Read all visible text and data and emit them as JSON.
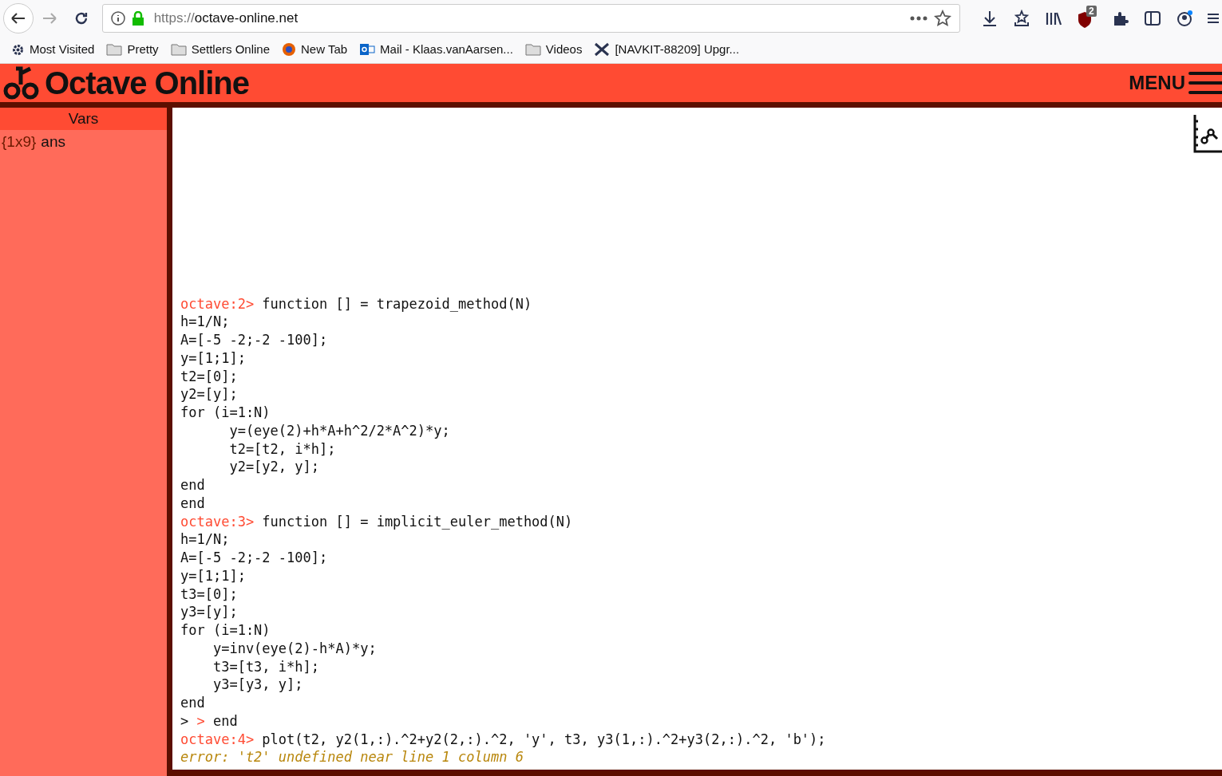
{
  "browser": {
    "url_scheme": "https://",
    "url_host": "octave-online.net",
    "extension_badge": "2"
  },
  "bookmarks": [
    {
      "kind": "gear",
      "label": "Most Visited"
    },
    {
      "kind": "folder",
      "label": "Pretty"
    },
    {
      "kind": "folder",
      "label": "Settlers Online"
    },
    {
      "kind": "globe",
      "label": "New Tab"
    },
    {
      "kind": "mail",
      "label": "Mail - Klaas.vanAarsen..."
    },
    {
      "kind": "folder",
      "label": "Videos"
    },
    {
      "kind": "tool",
      "label": "[NAVKIT-88209] Upgr..."
    }
  ],
  "app": {
    "logo_text": "Octave Online",
    "menu_label": "MENU"
  },
  "vars": {
    "title": "Vars",
    "items": [
      {
        "size": "{1x9}",
        "name": "ans"
      }
    ]
  },
  "console": {
    "lines": [
      [
        {
          "kind": "prompt",
          "text": "octave:2> "
        },
        {
          "kind": "code",
          "text": "function [] = trapezoid_method(N)"
        }
      ],
      [
        {
          "kind": "code",
          "text": "h=1/N;"
        }
      ],
      [
        {
          "kind": "code",
          "text": "A=[-5 -2;-2 -100];"
        }
      ],
      [
        {
          "kind": "code",
          "text": "y=[1;1];"
        }
      ],
      [
        {
          "kind": "code",
          "text": "t2=[0];"
        }
      ],
      [
        {
          "kind": "code",
          "text": "y2=[y];"
        }
      ],
      [
        {
          "kind": "code",
          "text": "for (i=1:N)"
        }
      ],
      [
        {
          "kind": "code",
          "text": "      y=(eye(2)+h*A+h^2/2*A^2)*y;"
        }
      ],
      [
        {
          "kind": "code",
          "text": "      t2=[t2, i*h];"
        }
      ],
      [
        {
          "kind": "code",
          "text": "      y2=[y2, y];"
        }
      ],
      [
        {
          "kind": "code",
          "text": "end"
        }
      ],
      [
        {
          "kind": "code",
          "text": "end"
        }
      ],
      [
        {
          "kind": "prompt",
          "text": "octave:3> "
        },
        {
          "kind": "code",
          "text": "function [] = implicit_euler_method(N)"
        }
      ],
      [
        {
          "kind": "code",
          "text": "h=1/N;"
        }
      ],
      [
        {
          "kind": "code",
          "text": "A=[-5 -2;-2 -100];"
        }
      ],
      [
        {
          "kind": "code",
          "text": "y=[1;1];"
        }
      ],
      [
        {
          "kind": "code",
          "text": "t3=[0];"
        }
      ],
      [
        {
          "kind": "code",
          "text": "y3=[y];"
        }
      ],
      [
        {
          "kind": "code",
          "text": "for (i=1:N)"
        }
      ],
      [
        {
          "kind": "code",
          "text": "    y=inv(eye(2)-h*A)*y;"
        }
      ],
      [
        {
          "kind": "code",
          "text": "    t3=[t3, i*h];"
        }
      ],
      [
        {
          "kind": "code",
          "text": "    y3=[y3, y];"
        }
      ],
      [
        {
          "kind": "code",
          "text": "end"
        }
      ],
      [
        {
          "kind": "code",
          "text": "> "
        },
        {
          "kind": "prompt",
          "text": "> "
        },
        {
          "kind": "code",
          "text": "end"
        }
      ],
      [
        {
          "kind": "prompt",
          "text": "octave:4> "
        },
        {
          "kind": "code",
          "text": "plot(t2, y2(1,:).^2+y2(2,:).^2, 'y', t3, y3(1,:).^2+y3(2,:).^2, 'b');"
        }
      ],
      [
        {
          "kind": "error",
          "text": "error: 't2' undefined near line 1 column 6"
        }
      ]
    ]
  }
}
